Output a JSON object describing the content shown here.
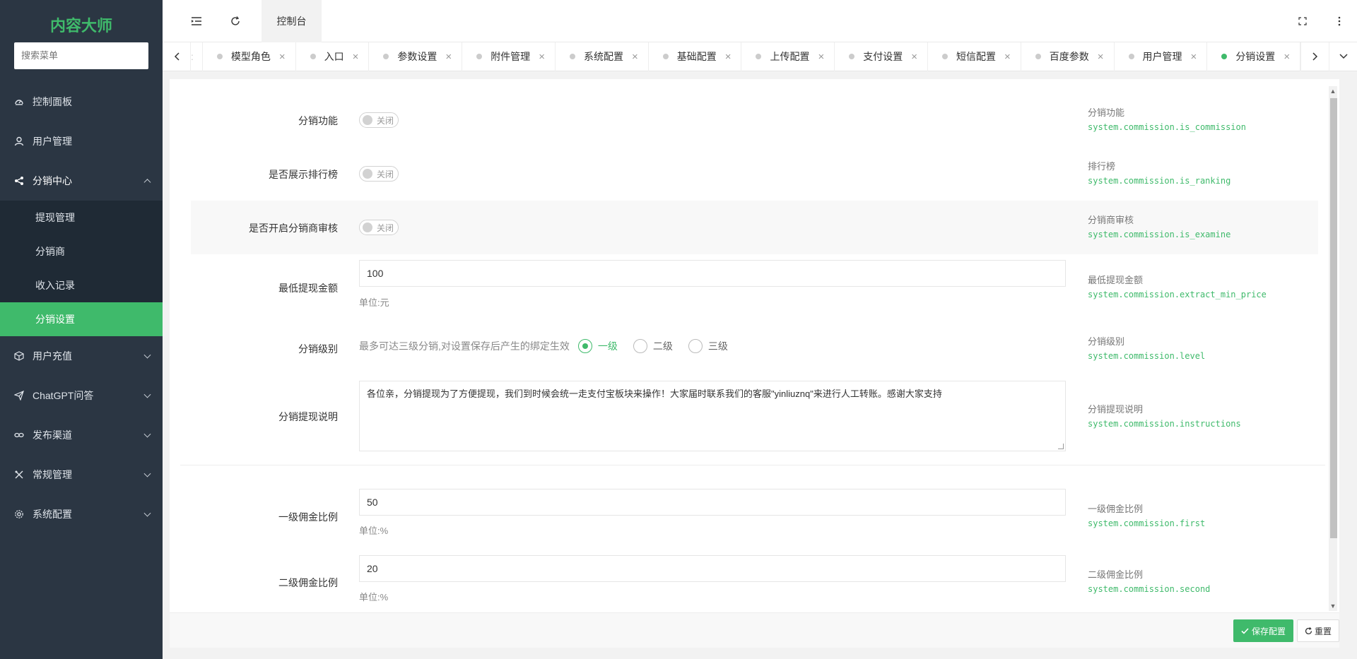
{
  "app": {
    "title": "内容大师",
    "search_placeholder": "搜索菜单"
  },
  "sidebar": {
    "items": [
      {
        "label": "控制面板",
        "icon": "dashboard-icon"
      },
      {
        "label": "用户管理",
        "icon": "user-icon"
      },
      {
        "label": "分销中心",
        "icon": "share-icon",
        "open": true,
        "children": [
          {
            "label": "提现管理"
          },
          {
            "label": "分销商"
          },
          {
            "label": "收入记录"
          },
          {
            "label": "分销设置",
            "active": true
          }
        ]
      },
      {
        "label": "用户充值",
        "icon": "box-icon"
      },
      {
        "label": "ChatGPT问答",
        "icon": "send-icon"
      },
      {
        "label": "发布渠道",
        "icon": "link-icon"
      },
      {
        "label": "常规管理",
        "icon": "tools-icon"
      },
      {
        "label": "系统配置",
        "icon": "gear-icon"
      }
    ]
  },
  "header": {
    "dashboard_tab": "控制台"
  },
  "tabs": [
    {
      "label": "模型角色"
    },
    {
      "label": "入口"
    },
    {
      "label": "参数设置"
    },
    {
      "label": "附件管理"
    },
    {
      "label": "系统配置"
    },
    {
      "label": "基础配置"
    },
    {
      "label": "上传配置"
    },
    {
      "label": "支付设置"
    },
    {
      "label": "短信配置"
    },
    {
      "label": "百度参数"
    },
    {
      "label": "用户管理"
    },
    {
      "label": "分销设置",
      "active": true
    }
  ],
  "form": {
    "is_commission": {
      "label": "分销功能",
      "state": "关闭",
      "help_title": "分销功能",
      "help_key": "system.commission.is_commission"
    },
    "is_ranking": {
      "label": "是否展示排行榜",
      "state": "关闭",
      "help_title": "排行榜",
      "help_key": "system.commission.is_ranking"
    },
    "is_examine": {
      "label": "是否开启分销商审核",
      "state": "关闭",
      "help_title": "分销商审核",
      "help_key": "system.commission.is_examine"
    },
    "extract_min_price": {
      "label": "最低提现金额",
      "value": "100",
      "unit": "单位:元",
      "help_title": "最低提现金额",
      "help_key": "system.commission.extract_min_price"
    },
    "level": {
      "label": "分销级别",
      "hint": "最多可达三级分销,对设置保存后产生的绑定生效",
      "options": [
        "一级",
        "二级",
        "三级"
      ],
      "selected": "一级",
      "help_title": "分销级别",
      "help_key": "system.commission.level"
    },
    "instructions": {
      "label": "分销提现说明",
      "value": "各位亲，分销提现为了方便提现，我们到时候会统一走支付宝板块来操作！大家届时联系我们的客服\"yinliuznq\"来进行人工转账。感谢大家支持",
      "help_title": "分销提现说明",
      "help_key": "system.commission.instructions"
    },
    "first": {
      "label": "一级佣金比例",
      "value": "50",
      "unit": "单位:%",
      "help_title": "一级佣金比例",
      "help_key": "system.commission.first"
    },
    "second": {
      "label": "二级佣金比例",
      "value": "20",
      "unit": "单位:%",
      "help_title": "二级佣金比例",
      "help_key": "system.commission.second"
    }
  },
  "footer": {
    "save_label": "保存配置",
    "reset_label": "重置"
  },
  "colors": {
    "accent": "#3fba6b",
    "sidebar_bg": "#2b3643",
    "submenu_bg": "#1f2a35"
  }
}
